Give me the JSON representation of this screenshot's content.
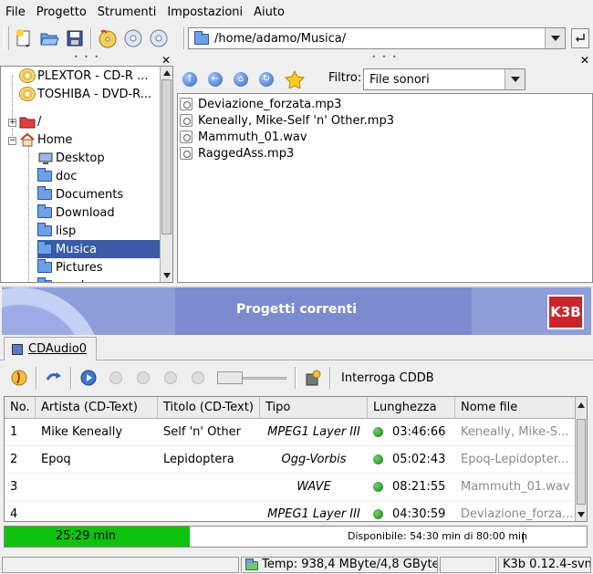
{
  "menu": [
    "File",
    "Progetto",
    "Strumenti",
    "Impostazioni",
    "Aiuto"
  ],
  "path": {
    "value": "/home/adamo/Musica/"
  },
  "tree": {
    "items": [
      {
        "label": "PLEXTOR - CD-R     ...",
        "icon": "cd-icon"
      },
      {
        "label": "TOSHIBA - DVD-R...",
        "icon": "cd-icon"
      },
      {
        "label": "/",
        "icon": "folder-red-icon"
      },
      {
        "label": "Home",
        "icon": "home-icon"
      },
      {
        "label": "Desktop",
        "icon": "desktop-icon"
      },
      {
        "label": "doc",
        "icon": "folder-icon"
      },
      {
        "label": "Documents",
        "icon": "folder-icon"
      },
      {
        "label": "Download",
        "icon": "folder-icon"
      },
      {
        "label": "lisp",
        "icon": "folder-icon"
      },
      {
        "label": "Musica",
        "icon": "folder-icon",
        "selected": true
      },
      {
        "label": "Pictures",
        "icon": "folder-icon"
      },
      {
        "label": "sgml",
        "icon": "folder-icon"
      }
    ]
  },
  "filter": {
    "label": "Filtro:",
    "value": "File sonori"
  },
  "files": [
    "Deviazione_forzata.mp3",
    "Keneally, Mike-Self 'n' Other.mp3",
    "Mammuth_01.wav",
    "RaggedAss.mp3"
  ],
  "banner": {
    "title": "Progetti correnti"
  },
  "project_tab": {
    "label": "CDAudio0"
  },
  "project_toolbar": {
    "cddb_label": "Interroga CDDB"
  },
  "table": {
    "headers": [
      "No.",
      "Artista (CD-Text)",
      "Titolo (CD-Text)",
      "Tipo",
      "Lunghezza",
      "Nome file"
    ],
    "rows": [
      {
        "no": "1",
        "artist": "Mike Keneally",
        "title": "Self 'n' Other",
        "type": "MPEG1 Layer III",
        "length": "03:46:66",
        "file": "Keneally, Mike-S..."
      },
      {
        "no": "2",
        "artist": "Epoq",
        "title": "Lepidoptera",
        "type": "Ogg-Vorbis",
        "length": "05:02:43",
        "file": "Epoq-Lepidopter..."
      },
      {
        "no": "3",
        "artist": "",
        "title": "",
        "type": "WAVE",
        "length": "08:21:55",
        "file": "Mammuth_01.wav"
      },
      {
        "no": "4",
        "artist": "",
        "title": "",
        "type": "MPEG1 Layer III",
        "length": "04:30:59",
        "file": "Deviazione_forza..."
      }
    ]
  },
  "size": {
    "used": "25:29 min",
    "available": "Disponibile: 54:30 min di 80:00 min",
    "fill_fraction": 0.318
  },
  "status": {
    "temp": "Temp: 938,4 MByte/4,8 GByte",
    "version": "K3b 0.12.4-svn"
  },
  "colors": {
    "selection": "#3a5ba5",
    "progress": "#0ec20e",
    "banner": "#8e9ed8"
  }
}
